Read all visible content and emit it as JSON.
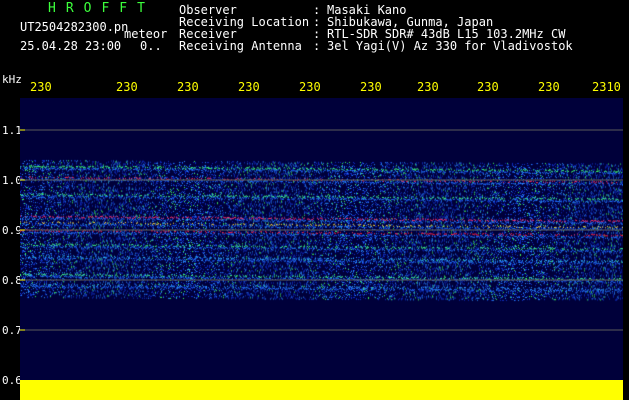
{
  "header": {
    "app_title": "HROFFT",
    "file_name": "UT2504282300.pn",
    "file_type": "meteor",
    "date_time": "25.04.28 23:00",
    "count": "0..",
    "info": [
      {
        "label": "Observer",
        "value": "Masaki Kano"
      },
      {
        "label": "Receiving Location",
        "value": "Shibukawa, Gunma, Japan"
      },
      {
        "label": "Receiver",
        "value": "RTL-SDR SDR# 43dB L15 103.2MHz CW"
      },
      {
        "label": "Receiving Antenna",
        "value": "3el Yagi(V) Az 330 for Vladivostok"
      }
    ]
  },
  "axes": {
    "unit": "kHz",
    "time_ticks": [
      "230",
      "230",
      "230",
      "230",
      "230",
      "230",
      "230",
      "230",
      "230",
      "2310"
    ],
    "freq_ticks": [
      "1.1",
      "1.0",
      "0.9",
      "0.8",
      "0.7",
      "0.6"
    ]
  },
  "colors": {
    "background": "#000000",
    "title": "#3cff3c",
    "text": "#ffffff",
    "ticks": "#ffff00",
    "plot_bg": "#00003a",
    "noise_floor": "#ffff00"
  }
}
